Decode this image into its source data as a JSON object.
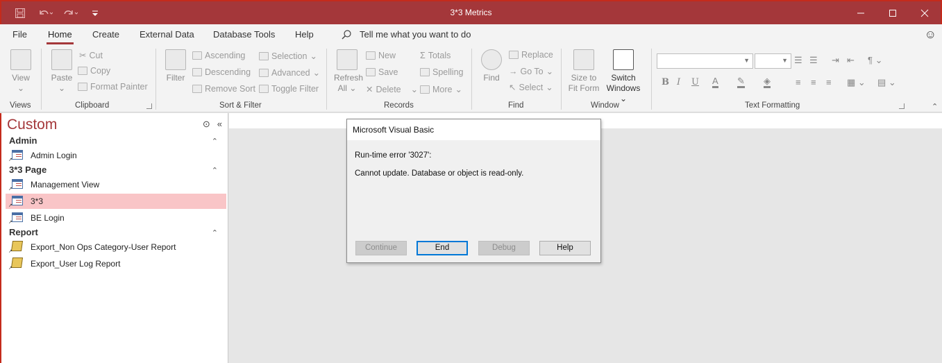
{
  "window": {
    "title": "3*3 Metrics",
    "qat": [
      "save-icon",
      "undo-icon",
      "redo-icon",
      "customize-qat-icon"
    ],
    "controls": [
      "minimize-icon",
      "maximize-icon",
      "close-icon"
    ],
    "accent": "#a4373a"
  },
  "tabs": {
    "file": "File",
    "home": "Home",
    "create": "Create",
    "external_data": "External Data",
    "database_tools": "Database Tools",
    "help": "Help",
    "tell_me": "Tell me what you want to do"
  },
  "ribbon": {
    "views": {
      "label": "Views",
      "view": "View"
    },
    "clipboard": {
      "label": "Clipboard",
      "paste": "Paste",
      "cut": "Cut",
      "copy": "Copy",
      "format_painter": "Format Painter"
    },
    "sort_filter": {
      "label": "Sort & Filter",
      "filter": "Filter",
      "ascending": "Ascending",
      "descending": "Descending",
      "remove_sort": "Remove Sort",
      "selection": "Selection",
      "advanced": "Advanced",
      "toggle_filter": "Toggle Filter"
    },
    "records": {
      "label": "Records",
      "refresh_all_1": "Refresh",
      "refresh_all_2": "All",
      "new": "New",
      "save": "Save",
      "delete": "Delete",
      "totals": "Totals",
      "spelling": "Spelling",
      "more": "More"
    },
    "find": {
      "label": "Find",
      "find": "Find",
      "replace": "Replace",
      "go_to": "Go To",
      "select": "Select"
    },
    "window": {
      "label": "Window",
      "size_to_fit_1": "Size to",
      "size_to_fit_2": "Fit Form",
      "switch_windows_1": "Switch",
      "switch_windows_2": "Windows"
    },
    "text_formatting": {
      "label": "Text Formatting",
      "bold": "B",
      "italic": "I",
      "underline": "U",
      "font_color": "A"
    }
  },
  "nav": {
    "title": "Custom",
    "groups": [
      {
        "name": "Admin",
        "items": [
          {
            "label": "Admin Login",
            "type": "form"
          }
        ]
      },
      {
        "name": "3*3 Page",
        "items": [
          {
            "label": "Management View",
            "type": "form"
          },
          {
            "label": "3*3",
            "type": "form",
            "selected": true
          },
          {
            "label": "BE Login",
            "type": "form"
          }
        ]
      },
      {
        "name": "Report",
        "items": [
          {
            "label": "Export_Non Ops Category-User Report",
            "type": "report"
          },
          {
            "label": "Export_User Log Report",
            "type": "report"
          }
        ]
      }
    ]
  },
  "dialog": {
    "title": "Microsoft Visual Basic",
    "message1": "Run-time error '3027':",
    "message2": "Cannot update. Database or object is read-only.",
    "buttons": {
      "continue": "Continue",
      "end": "End",
      "debug": "Debug",
      "help": "Help"
    }
  }
}
